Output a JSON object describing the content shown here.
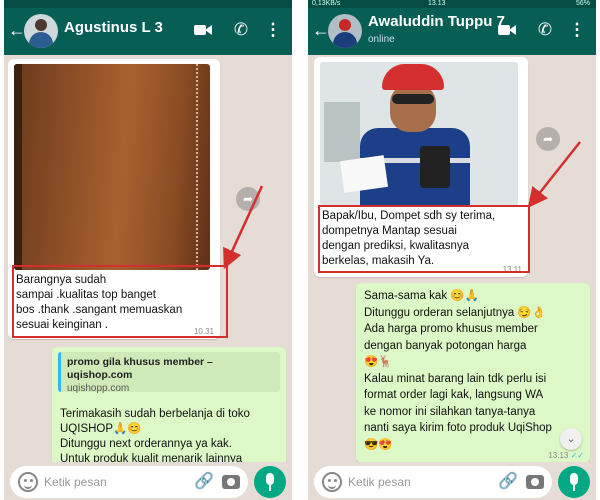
{
  "left": {
    "status": {
      "left": "",
      "time": "",
      "right": ""
    },
    "contact_name": "Agustinus L 3",
    "received_message": {
      "lines": [
        "Barangnya sudah",
        "sampai .kualitas top banget",
        "bos .thank .sangant memuaskan",
        "sesuai keinginan ."
      ],
      "time": "10.31"
    },
    "sent_message": {
      "link_title_1": "promo gila khusus member –",
      "link_title_2": "uqishop.com",
      "link_url": "uqishopp.com",
      "lines": [
        "Terimakasih sudah berbelanja di toko",
        "UQISHOP🙏😊",
        "Ditunggu next orderannya ya kak.",
        "Untuk produk kualit menarik lainnya"
      ]
    },
    "input_placeholder": "Ketik pesan"
  },
  "right": {
    "status": {
      "left": "0,13KB/s",
      "time": "13.13",
      "right": "56%"
    },
    "contact_name": "Awaluddin Tuppu 7",
    "contact_status": "online",
    "received_message": {
      "lines": [
        "Bapak/Ibu, Dompet sdh sy terima,",
        "dompetnya Mantap sesuai",
        "dengan prediksi, kwalitasnya",
        "berkelas, makasih Ya."
      ],
      "time": "13.11"
    },
    "sent_message": {
      "lines": [
        "Sama-sama kak 😊🙏",
        "Ditunggu orderan selanjutnya 😏👌",
        "Ada harga promo khusus member",
        "dengan banyak potongan harga",
        "😍🦌",
        "Kalau minat barang lain tdk perlu isi",
        "format order lagi kak, langsung WA",
        "ke nomor ini silahkan tanya-tanya",
        "nanti saya kirim foto produk UqiShop",
        "😎😍"
      ],
      "time": "13.13"
    },
    "input_placeholder": "Ketik pesan"
  },
  "colors": {
    "header": "#075e54",
    "status_bar": "#054d44",
    "chat_bg": "#e5ddd5",
    "outgoing": "#dcf8c6",
    "highlight": "#d32f2f",
    "mic": "#00a884"
  }
}
